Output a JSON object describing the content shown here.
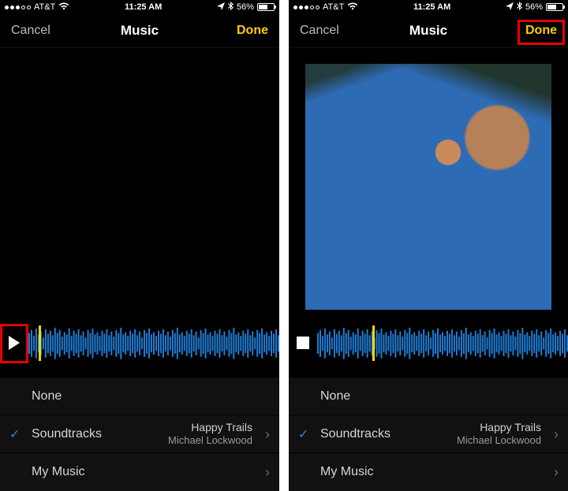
{
  "status": {
    "carrier": "AT&T",
    "time": "11:25 AM",
    "battery_pct": "56%"
  },
  "nav": {
    "cancel": "Cancel",
    "title": "Music",
    "done": "Done"
  },
  "options": {
    "none": "None",
    "soundtracks": "Soundtracks",
    "my_music": "My Music",
    "selected_track": "Happy Trails",
    "selected_artist": "Michael Lockwood"
  },
  "left_panel": {
    "scrub_pct": 4,
    "play_state": "paused"
  },
  "right_panel": {
    "scrub_pct": 22,
    "play_state": "playing"
  }
}
